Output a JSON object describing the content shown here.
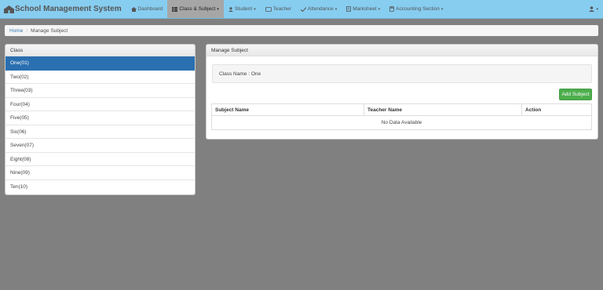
{
  "navbar": {
    "brand": "School Management System",
    "items": [
      {
        "label": "Dashboard",
        "icon": "home-icon",
        "dropdown": false,
        "active": false
      },
      {
        "label": "Class & Subject",
        "icon": "table-icon",
        "dropdown": true,
        "active": true
      },
      {
        "label": "Student",
        "icon": "user-icon",
        "dropdown": true,
        "active": false
      },
      {
        "label": "Teacher",
        "icon": "teacher-icon",
        "dropdown": false,
        "active": false
      },
      {
        "label": "Attendance",
        "icon": "attendance-icon",
        "dropdown": true,
        "active": false
      },
      {
        "label": "Marksheet",
        "icon": "marksheet-icon",
        "dropdown": true,
        "active": false
      },
      {
        "label": "Accounting Section",
        "icon": "accounting-icon",
        "dropdown": true,
        "active": false
      }
    ],
    "user_icon": "user-icon"
  },
  "breadcrumb": {
    "home": "Home",
    "current": "Manage Subject"
  },
  "class_panel": {
    "heading": "Class",
    "items": [
      "One(01)",
      "Two(02)",
      "Three(03)",
      "Four(04)",
      "Five(05)",
      "Six(06)",
      "Seven(07)",
      "Eight(08)",
      "Nine(09)",
      "Ten(10)"
    ],
    "selected_index": 0
  },
  "manage_panel": {
    "heading": "Manage Subject",
    "class_name_text": "Class Name : One",
    "add_button": "Add Subject",
    "columns": [
      "Subject Name",
      "Teacher Name",
      "Action"
    ],
    "empty_message": "No Data Available"
  },
  "colors": {
    "navbar": "#87cdf0",
    "active_nav": "#a6a6a6",
    "selected_class": "#2a6fb0",
    "add_button": "#4cae4c",
    "background": "#808080"
  }
}
